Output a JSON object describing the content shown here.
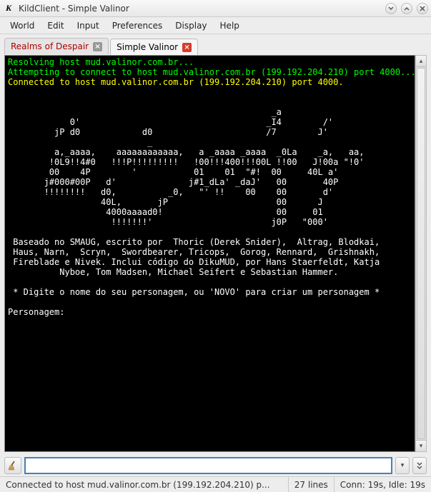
{
  "window": {
    "title": "KildClient - Simple Valinor"
  },
  "menu": {
    "items": [
      "World",
      "Edit",
      "Input",
      "Preferences",
      "Display",
      "Help"
    ]
  },
  "tabs": [
    {
      "label": "Realms of Despair",
      "active": false,
      "red": true,
      "closeStyle": "gray"
    },
    {
      "label": "Simple Valinor",
      "active": true,
      "red": false,
      "closeStyle": "red"
    }
  ],
  "terminal": {
    "lines": [
      {
        "cls": "green",
        "text": "Resolving host mud.valinor.com.br..."
      },
      {
        "cls": "green",
        "text": "Attempting to connect to host mud.valinor.com.br (199.192.204.210) port 4000..."
      },
      {
        "cls": "yellow",
        "text": "Connected to host mud.valinor.com.br (199.192.204.210) port 4000."
      },
      {
        "cls": "",
        "text": ""
      },
      {
        "cls": "",
        "text": ""
      },
      {
        "cls": "",
        "text": "                                                   _a"
      },
      {
        "cls": "",
        "text": "            0'                                    _I4        /'"
      },
      {
        "cls": "",
        "text": "         jP d0            d0                      /7        J'"
      },
      {
        "cls": "",
        "text": "                           _"
      },
      {
        "cls": "",
        "text": "         a,_aaaa,    aaaaaaaaaaaa,   a _aaaa _aaaa  _0La    _a,   aa,"
      },
      {
        "cls": "",
        "text": "        !0L9!!4#0   !!!P!!!!!!!!!   !00!!!400!!!00L !!00   J!00a \"!0'"
      },
      {
        "cls": "",
        "text": "        00    4P        '           01    01  \"#!  00     40L a'"
      },
      {
        "cls": "",
        "text": "       j#000#00P   d'              j#1_dLa' _daJ'   00       40P"
      },
      {
        "cls": "",
        "text": "       !!!!!!!!   d0,          _0,   \"' !!    00    00       d'"
      },
      {
        "cls": "",
        "text": "                  40L,       jP                     00      J"
      },
      {
        "cls": "",
        "text": "                   4000aaaad0!                      00     01"
      },
      {
        "cls": "",
        "text": "                    !!!!!!!'                       j0P   \"000'"
      },
      {
        "cls": "",
        "text": ""
      },
      {
        "cls": "",
        "text": " Baseado no SMAUG, escrito por  Thoric (Derek Snider),  Altrag, Blodkai,"
      },
      {
        "cls": "",
        "text": " Haus, Narn,  Scryn,  Swordbearer, Tricops,  Gorog, Rennard,  Grishnakh,"
      },
      {
        "cls": "",
        "text": " Fireblade e Nivek. Inclui código do DikuMUD, por Hans Staerfeldt, Katja"
      },
      {
        "cls": "",
        "text": "          Nyboe, Tom Madsen, Michael Seifert e Sebastian Hammer."
      },
      {
        "cls": "",
        "text": ""
      },
      {
        "cls": "",
        "text": " * Digite o nome do seu personagem, ou 'NOVO' para criar um personagem *"
      },
      {
        "cls": "",
        "text": ""
      },
      {
        "cls": "",
        "text": "Personagem:"
      }
    ]
  },
  "input": {
    "value": ""
  },
  "status": {
    "connection": "Connected to host mud.valinor.com.br (199.192.204.210) p...",
    "lines": "27 lines",
    "timers": "Conn: 19s, Idle: 19s"
  }
}
